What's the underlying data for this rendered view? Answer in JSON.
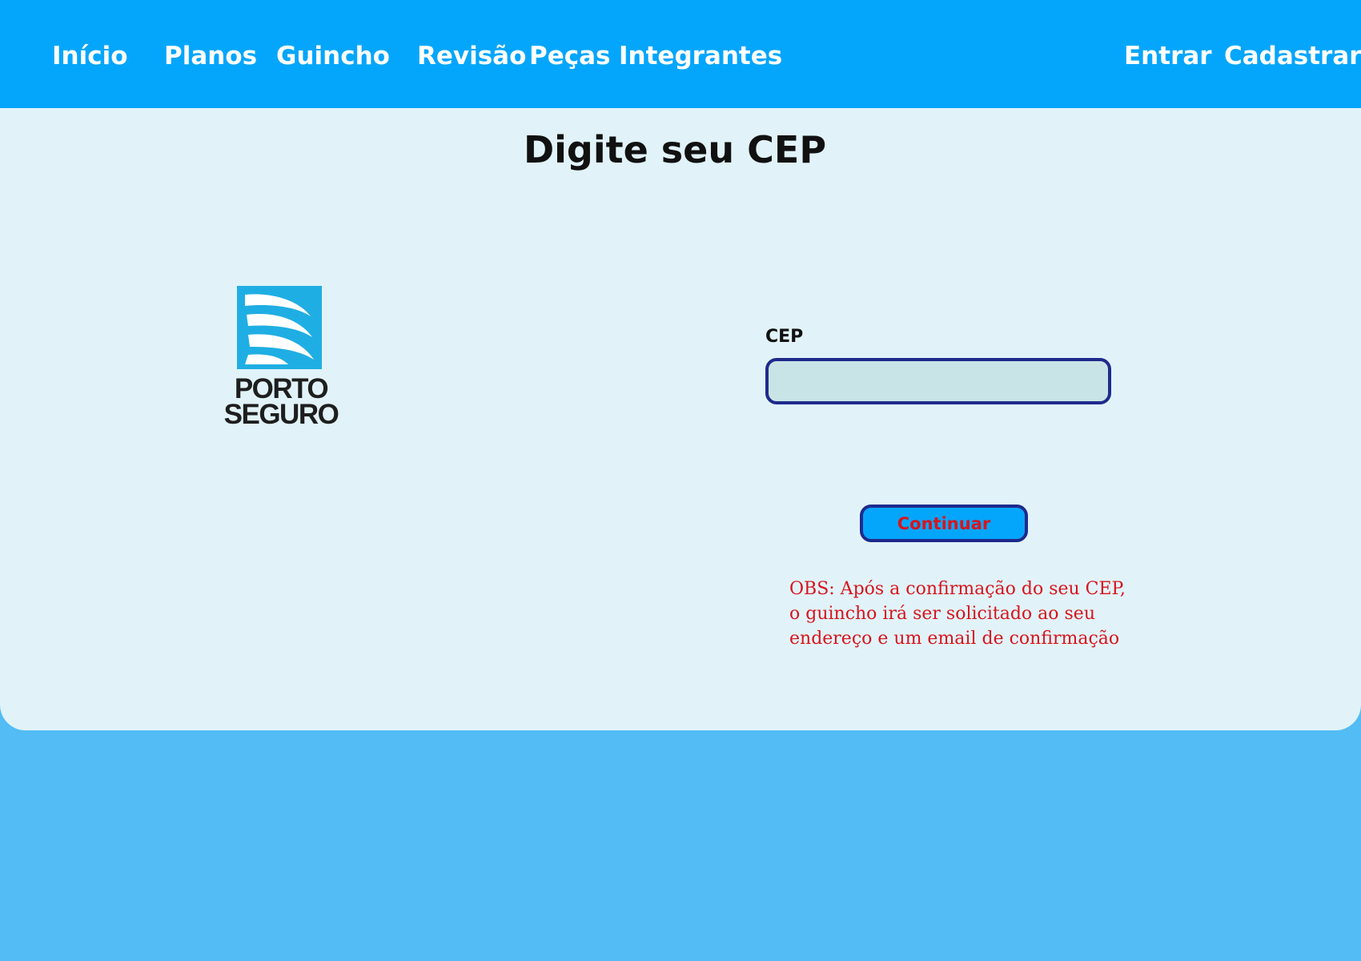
{
  "nav": {
    "left_items": [
      {
        "label": "Início"
      },
      {
        "label": "Planos"
      },
      {
        "label": "Guincho"
      },
      {
        "label": "Revisão"
      },
      {
        "label": "Peças"
      },
      {
        "label": "Integrantes"
      }
    ],
    "right_items": [
      {
        "label": "Entrar"
      },
      {
        "label": "Cadastrar"
      }
    ]
  },
  "main": {
    "title": "Digite seu CEP",
    "logo": {
      "line1": "PORTO",
      "line2": "SEGURO",
      "icon": "porto-seguro-sail-icon"
    },
    "form": {
      "cep_label": "CEP",
      "cep_value": "",
      "cep_placeholder": "",
      "continue_label": "Continuar"
    },
    "obs": "OBS: Após a confirmação do seu CEP, o guincho irá ser solicitado ao seu endereço e um email de confirmação"
  },
  "colors": {
    "navbar": "#04a6fc",
    "panel": "#e1f3f9",
    "page_background": "#53bcf5",
    "input_border": "#1f2a8c",
    "input_fill": "#c9e4e6",
    "alert_text": "#d8141d",
    "logo_blue": "#1faee3"
  }
}
